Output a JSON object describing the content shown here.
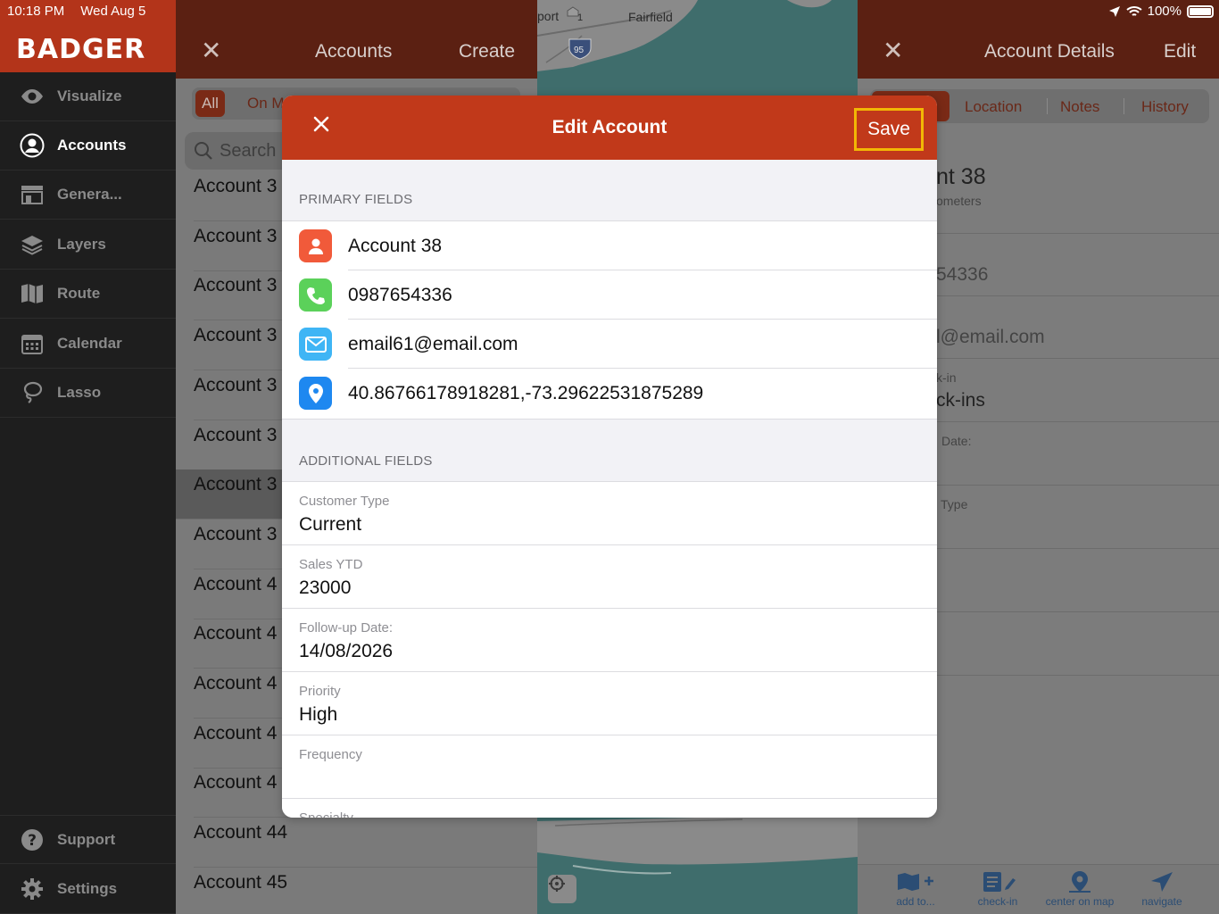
{
  "status": {
    "time": "10:18 PM",
    "date": "Wed Aug 5",
    "battery": "100%"
  },
  "sidebar": {
    "brand": "BADGER",
    "items": [
      {
        "label": "Visualize",
        "icon": "eye-icon"
      },
      {
        "label": "Accounts",
        "icon": "person-circle-icon"
      },
      {
        "label": "Genera...",
        "icon": "storefront-icon"
      },
      {
        "label": "Layers",
        "icon": "layers-icon"
      },
      {
        "label": "Route",
        "icon": "map-icon"
      },
      {
        "label": "Calendar",
        "icon": "calendar-icon"
      },
      {
        "label": "Lasso",
        "icon": "lasso-icon"
      }
    ],
    "bottom": [
      {
        "label": "Support",
        "icon": "question-icon"
      },
      {
        "label": "Settings",
        "icon": "gear-icon"
      }
    ]
  },
  "accounts": {
    "title": "Accounts",
    "create": "Create",
    "filter_all": "All",
    "filter_other": "On M",
    "search_placeholder": "Search",
    "rows": [
      "Account 3",
      "Account 3",
      "Account 3",
      "Account 3",
      "Account 3",
      "Account 3",
      "Account 3",
      "Account 3",
      "Account 4",
      "Account 4",
      "Account 4",
      "Account 4",
      "Account 4",
      "Account 44",
      "Account 45"
    ]
  },
  "map": {
    "labels": [
      "port",
      "Fairfield",
      "1",
      "95"
    ]
  },
  "details": {
    "title": "Account Details",
    "edit": "Edit",
    "tabs": [
      "Location",
      "Notes",
      "History"
    ],
    "name_fragment": "nt 38",
    "distance_fragment": "ometers",
    "phone_fragment": "54336",
    "email_fragment": "l@email.com",
    "checkin_label_fragment": "k-in",
    "checkin_value_fragment": "ck-ins",
    "date_fragment": "Date:",
    "type_fragment": "Type",
    "tabbar": [
      "add to...",
      "check-in",
      "center on map",
      "navigate"
    ]
  },
  "modal": {
    "title": "Edit Account",
    "save": "Save",
    "primary_header": "PRIMARY FIELDS",
    "primary": [
      {
        "value": "Account 38",
        "icon": "contact-icon",
        "color": "#f15a3a"
      },
      {
        "value": "0987654336",
        "icon": "phone-icon",
        "color": "#5bd15a"
      },
      {
        "value": "email61@email.com",
        "icon": "mail-icon",
        "color": "#3fb5f5"
      },
      {
        "value": "40.86766178918281,-73.29622531875289",
        "icon": "location-pin-icon",
        "color": "#1e88f0"
      }
    ],
    "additional_header": "ADDITIONAL FIELDS",
    "additional": [
      {
        "label": "Customer Type",
        "value": "Current"
      },
      {
        "label": "Sales YTD",
        "value": "23000"
      },
      {
        "label": "Follow-up Date:",
        "value": "14/08/2026"
      },
      {
        "label": "Priority",
        "value": "High"
      },
      {
        "label": "Frequency",
        "value": ""
      },
      {
        "label": "Specialty",
        "value": ""
      }
    ]
  }
}
